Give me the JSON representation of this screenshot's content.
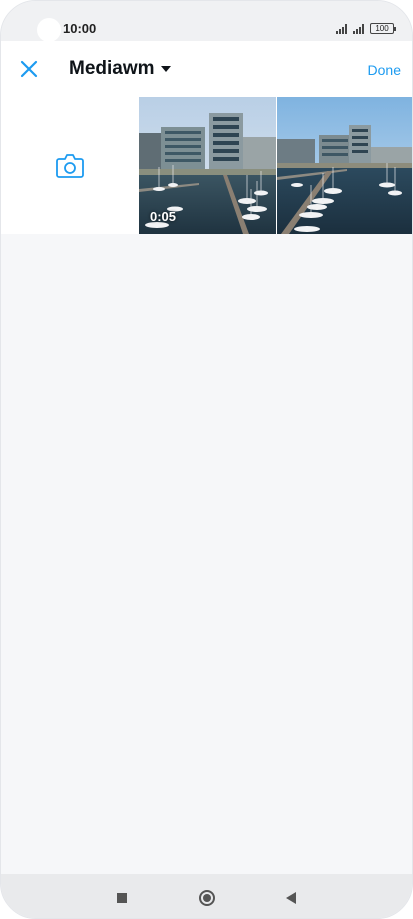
{
  "status_bar": {
    "time": "10:00",
    "battery": "100",
    "icons": [
      "signal-icon",
      "signal-icon",
      "battery-icon"
    ]
  },
  "header": {
    "title": "Mediawm",
    "done_label": "Done",
    "close_icon": "close-icon",
    "dropdown_icon": "caret-down-icon"
  },
  "grid": {
    "camera_icon": "camera-icon",
    "items": [
      {
        "type": "video",
        "duration": "0:05"
      },
      {
        "type": "image",
        "duration": ""
      }
    ]
  },
  "nav_bar": {
    "icons": [
      "recents-icon",
      "home-icon",
      "back-icon"
    ]
  },
  "colors": {
    "accent": "#1d9bf0",
    "background": "#f6f7f9",
    "text": "#0f1419"
  }
}
